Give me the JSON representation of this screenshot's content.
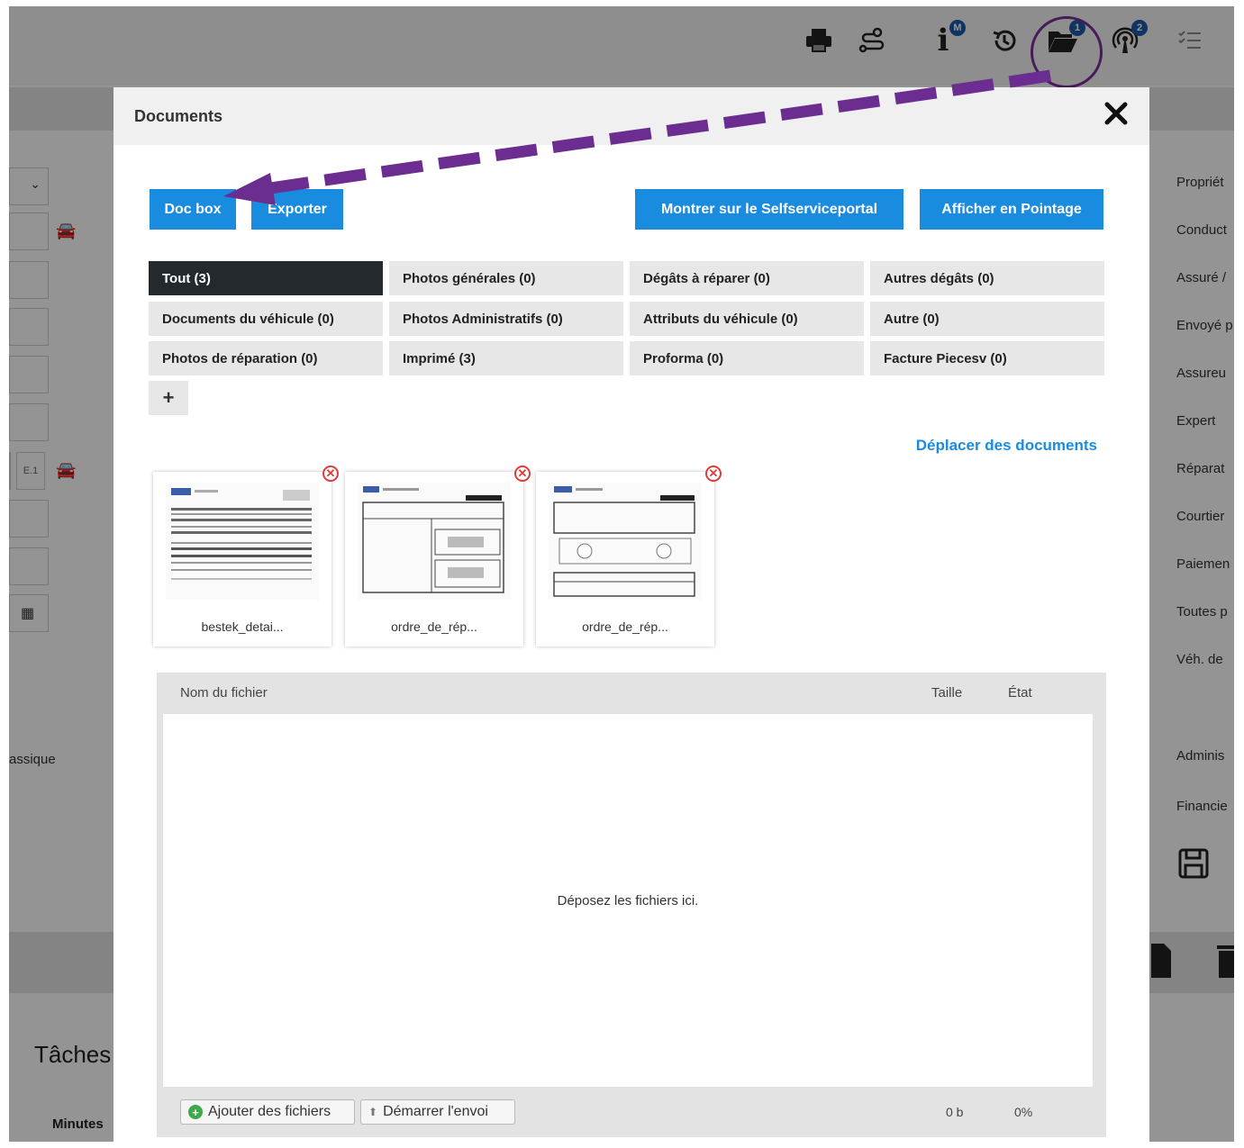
{
  "modal": {
    "title": "Documents",
    "close_label": "✕",
    "buttons": {
      "doc_box": "Doc box",
      "export": "Exporter",
      "selfservice": "Montrer sur le Selfserviceportal",
      "pointage": "Afficher en Pointage"
    },
    "tabs": [
      "Tout (3)",
      "Photos générales (0)",
      "Dégâts à réparer (0)",
      "Autres dégâts (0)",
      "Documents du véhicule (0)",
      "Photos Administratifs (0)",
      "Attributs du véhicule (0)",
      "Autre (0)",
      "Photos de réparation (0)",
      "Imprimé (3)",
      "Proforma (0)",
      "Facture Piecesv (0)"
    ],
    "add_tab": "+",
    "move_documents": "Déplacer des documents",
    "documents": [
      {
        "name": "bestek_detai..."
      },
      {
        "name": "ordre_de_rép..."
      },
      {
        "name": "ordre_de_rép..."
      }
    ],
    "uploader": {
      "col_name": "Nom du fichier",
      "col_size": "Taille",
      "col_state": "État",
      "dropzone": "Déposez les fichiers ici.",
      "add_files": "Ajouter des fichiers",
      "start_upload": "Démarrer l'envoi",
      "total_size": "0 b",
      "total_percent": "0%"
    }
  },
  "toolbar": {
    "badges": {
      "info": "M",
      "folder": "1",
      "broadcast": "2"
    }
  },
  "background": {
    "left_field_tag": "E.1",
    "left_text": "assique",
    "right_labels": [
      "Propriét",
      "Conduct",
      "Assuré /",
      "Envoyé p",
      "Assureu",
      "Expert",
      "Réparat",
      "Courtier",
      "Paiemen",
      "Toutes p",
      "Véh. de",
      "Adminis",
      "Financie"
    ],
    "tasks_title": "Tâches",
    "minutes_label": "Minutes"
  },
  "colors": {
    "accent": "#1a8ce0",
    "active_tab": "#24292e",
    "annotation": "#6b2d8f"
  }
}
